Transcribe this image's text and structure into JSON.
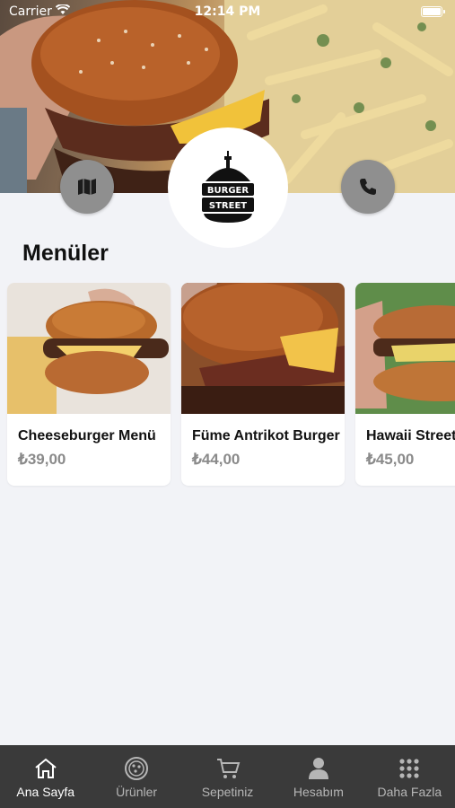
{
  "status_bar": {
    "carrier": "Carrier",
    "time": "12:14 PM"
  },
  "hero": {
    "logo_line1": "BURGER",
    "logo_line2": "STREET",
    "map_icon": "map-icon",
    "phone_icon": "phone-icon"
  },
  "menus": {
    "title": "Menüler",
    "items": [
      {
        "name": "Cheeseburger Menü",
        "price": "₺39,00"
      },
      {
        "name": "Füme Antrikot Burger",
        "price": "₺44,00"
      },
      {
        "name": "Hawaii Street",
        "price": "₺45,00"
      }
    ]
  },
  "tabbar": {
    "items": [
      {
        "label": "Ana Sayfa",
        "icon": "home-icon",
        "active": true
      },
      {
        "label": "Ürünler",
        "icon": "pizza-icon",
        "active": false
      },
      {
        "label": "Sepetiniz",
        "icon": "cart-icon",
        "active": false
      },
      {
        "label": "Hesabım",
        "icon": "user-icon",
        "active": false
      },
      {
        "label": "Daha Fazla",
        "icon": "grid-icon",
        "active": false
      }
    ]
  },
  "colors": {
    "tabbar_bg": "#3a3a3a",
    "page_bg": "#f2f3f7",
    "button_grey": "#8f8f8f",
    "price_grey": "#8a8a8a"
  }
}
